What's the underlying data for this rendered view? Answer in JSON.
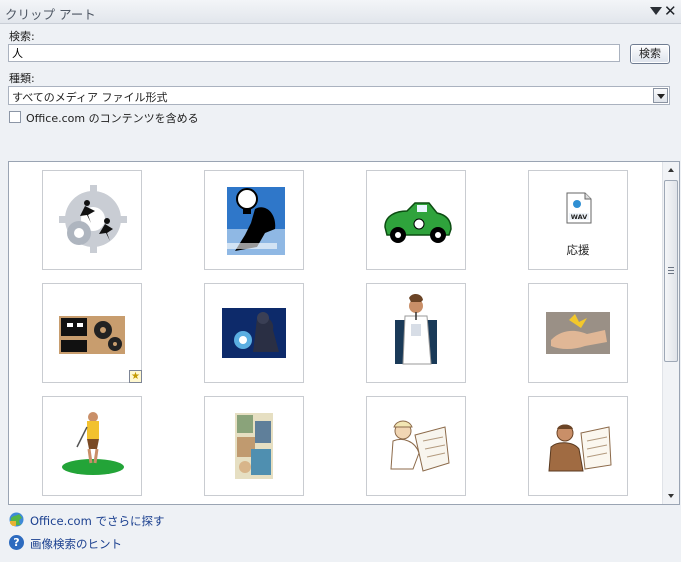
{
  "pane": {
    "title": "クリップ アート"
  },
  "search": {
    "label": "検索:",
    "value": "人",
    "button_label": "検索"
  },
  "type": {
    "label": "種類:",
    "selected": "すべてのメディア ファイル形式"
  },
  "include_office": {
    "label": "Office.com のコンテンツを含める",
    "checked": false
  },
  "results": {
    "items": [
      {
        "name": "gears-people"
      },
      {
        "name": "idea-bulb"
      },
      {
        "name": "green-car"
      },
      {
        "name": "wav-sound",
        "caption": "応援",
        "file_icon_text": "WAV"
      },
      {
        "name": "gears-chart",
        "badge": "star"
      },
      {
        "name": "welder"
      },
      {
        "name": "doctor"
      },
      {
        "name": "handshake"
      },
      {
        "name": "golfer"
      },
      {
        "name": "collage"
      },
      {
        "name": "engineer-plans"
      },
      {
        "name": "businessman"
      }
    ]
  },
  "footer": {
    "find_more": "Office.com でさらに探す",
    "hints": "画像検索のヒント",
    "hints_icon": "?"
  },
  "colors": {
    "link": "#1a3f8f",
    "accent": "#2d6bbf"
  }
}
